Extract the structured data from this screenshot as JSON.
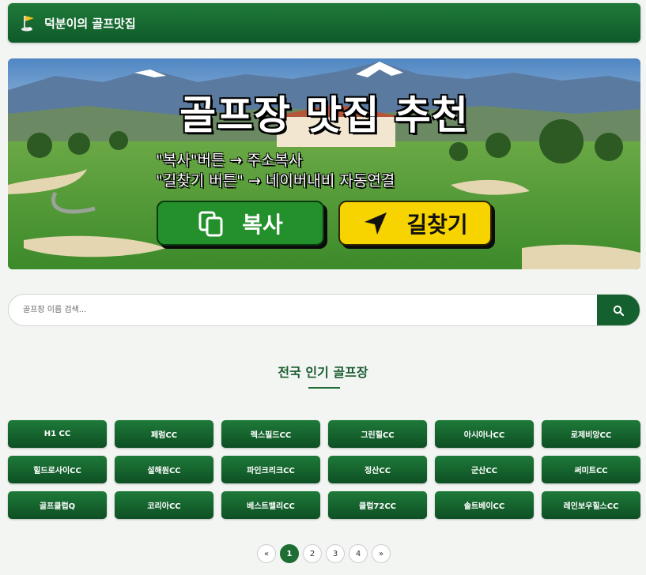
{
  "header": {
    "title": "덕분이의 골프맛집",
    "icon": "golf-flag-icon"
  },
  "banner": {
    "headline": "골프장 맛집 추천",
    "line1": "\"복사\"버튼 → 주소복사",
    "line2": "\"길찾기 버튼\" → 네이버내비 자동연결",
    "copy_label": "복사",
    "nav_label": "길찾기"
  },
  "search": {
    "placeholder": "골프장 이름 검색..."
  },
  "section": {
    "title": "전국 인기 골프장"
  },
  "courses": [
    "H1 CC",
    "페럼CC",
    "렉스필드CC",
    "그린힐CC",
    "아시아나CC",
    "로제비앙CC",
    "힐드로사이CC",
    "설해원CC",
    "파인크리크CC",
    "정산CC",
    "군산CC",
    "써미트CC",
    "골프클럽Q",
    "코리아CC",
    "베스트밸리CC",
    "클럽72CC",
    "솔트베이CC",
    "레인보우힐스CC"
  ],
  "pagination": {
    "prev": "«",
    "pages": [
      "1",
      "2",
      "3",
      "4"
    ],
    "next": "»",
    "current": "1"
  },
  "colors": {
    "primary": "#15602f",
    "accent_yellow": "#f7d400",
    "copy_green": "#23902b"
  }
}
